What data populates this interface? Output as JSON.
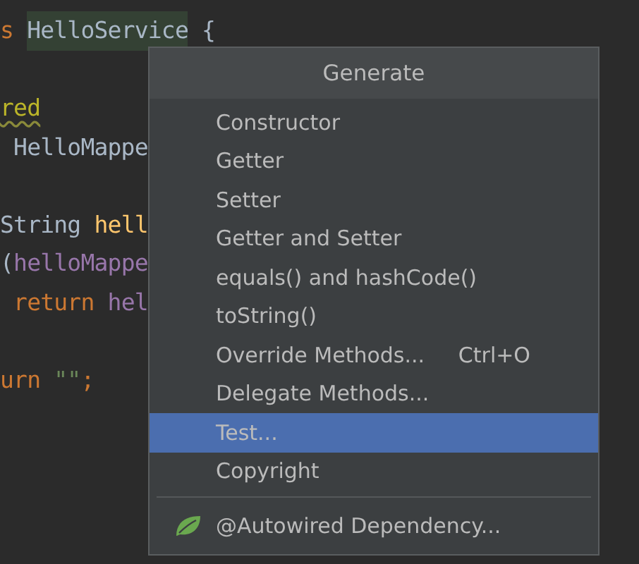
{
  "editor": {
    "lines": [
      {
        "kind": "code",
        "tokens": [
          {
            "text": "s ",
            "kind": "keyword"
          },
          {
            "text": "HelloService",
            "kind": "highlight"
          },
          {
            "text": " {",
            "kind": "plain"
          }
        ]
      },
      {
        "kind": "blank"
      },
      {
        "kind": "code",
        "tokens": [
          {
            "text": "red",
            "kind": "annotation"
          }
        ]
      },
      {
        "kind": "code",
        "tokens": [
          {
            "text": " HelloMappe",
            "kind": "plain"
          }
        ]
      },
      {
        "kind": "blank"
      },
      {
        "kind": "code",
        "tokens": [
          {
            "text": "String ",
            "kind": "plain"
          },
          {
            "text": "hell",
            "kind": "method"
          }
        ]
      },
      {
        "kind": "code",
        "tokens": [
          {
            "text": "(",
            "kind": "plain"
          },
          {
            "text": "helloMappe",
            "kind": "field"
          }
        ]
      },
      {
        "kind": "code",
        "tokens": [
          {
            "text": " return ",
            "kind": "keyword"
          },
          {
            "text": "hel",
            "kind": "field"
          }
        ]
      },
      {
        "kind": "blank"
      },
      {
        "kind": "code",
        "tokens": [
          {
            "text": "urn ",
            "kind": "keyword"
          },
          {
            "text": "\"\"",
            "kind": "string"
          },
          {
            "text": ";",
            "kind": "keyword"
          }
        ]
      }
    ]
  },
  "popup": {
    "title": "Generate",
    "items": [
      {
        "kind": "item",
        "label": "Constructor",
        "selected": false
      },
      {
        "kind": "item",
        "label": "Getter",
        "selected": false
      },
      {
        "kind": "item",
        "label": "Setter",
        "selected": false
      },
      {
        "kind": "item",
        "label": "Getter and Setter",
        "selected": false
      },
      {
        "kind": "item",
        "label": "equals() and hashCode()",
        "selected": false
      },
      {
        "kind": "item",
        "label": "toString()",
        "selected": false
      },
      {
        "kind": "item",
        "label": "Override Methods...",
        "shortcut": "Ctrl+O",
        "selected": false
      },
      {
        "kind": "item",
        "label": "Delegate Methods...",
        "selected": false
      },
      {
        "kind": "item",
        "label": "Test...",
        "selected": true
      },
      {
        "kind": "item",
        "label": "Copyright",
        "selected": false
      },
      {
        "kind": "separator"
      },
      {
        "kind": "leaf_item",
        "label": "@Autowired Dependency...",
        "selected": false
      }
    ]
  }
}
